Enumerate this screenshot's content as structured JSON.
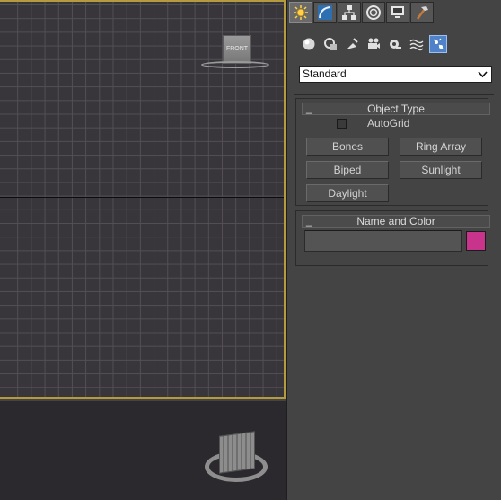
{
  "viewports": {
    "front": {
      "cube_label": "FRONT"
    }
  },
  "command_panel": {
    "tabs": [
      {
        "name": "create",
        "icon": "sun-icon",
        "active": true
      },
      {
        "name": "modify",
        "icon": "curve-icon",
        "active": false
      },
      {
        "name": "hierarchy",
        "icon": "hierarchy-icon",
        "active": false
      },
      {
        "name": "motion",
        "icon": "motion-icon",
        "active": false
      },
      {
        "name": "display",
        "icon": "monitor-icon",
        "active": false
      },
      {
        "name": "utilities",
        "icon": "hammer-icon",
        "active": false
      }
    ],
    "subtabs": [
      {
        "name": "geometry",
        "icon": "sphere-icon"
      },
      {
        "name": "shapes",
        "icon": "shapes-icon"
      },
      {
        "name": "lights",
        "icon": "light-icon"
      },
      {
        "name": "cameras",
        "icon": "camera-icon"
      },
      {
        "name": "helpers",
        "icon": "tape-icon"
      },
      {
        "name": "space-warps",
        "icon": "waves-icon"
      },
      {
        "name": "systems",
        "icon": "systems-icon",
        "active": true
      }
    ],
    "category": {
      "selected": "Standard"
    },
    "object_type": {
      "title": "Object Type",
      "collapse": "_",
      "autogrid_label": "AutoGrid",
      "autogrid_checked": false,
      "buttons": [
        "Bones",
        "Ring Array",
        "Biped",
        "Sunlight",
        "Daylight"
      ]
    },
    "name_and_color": {
      "title": "Name and Color",
      "collapse": "_",
      "name_value": "",
      "color": "#c8348c"
    }
  },
  "colors": {
    "viewport_border_active": "#b59a3e",
    "panel_bg": "#444444",
    "subtab_active": "#4f82c8"
  }
}
